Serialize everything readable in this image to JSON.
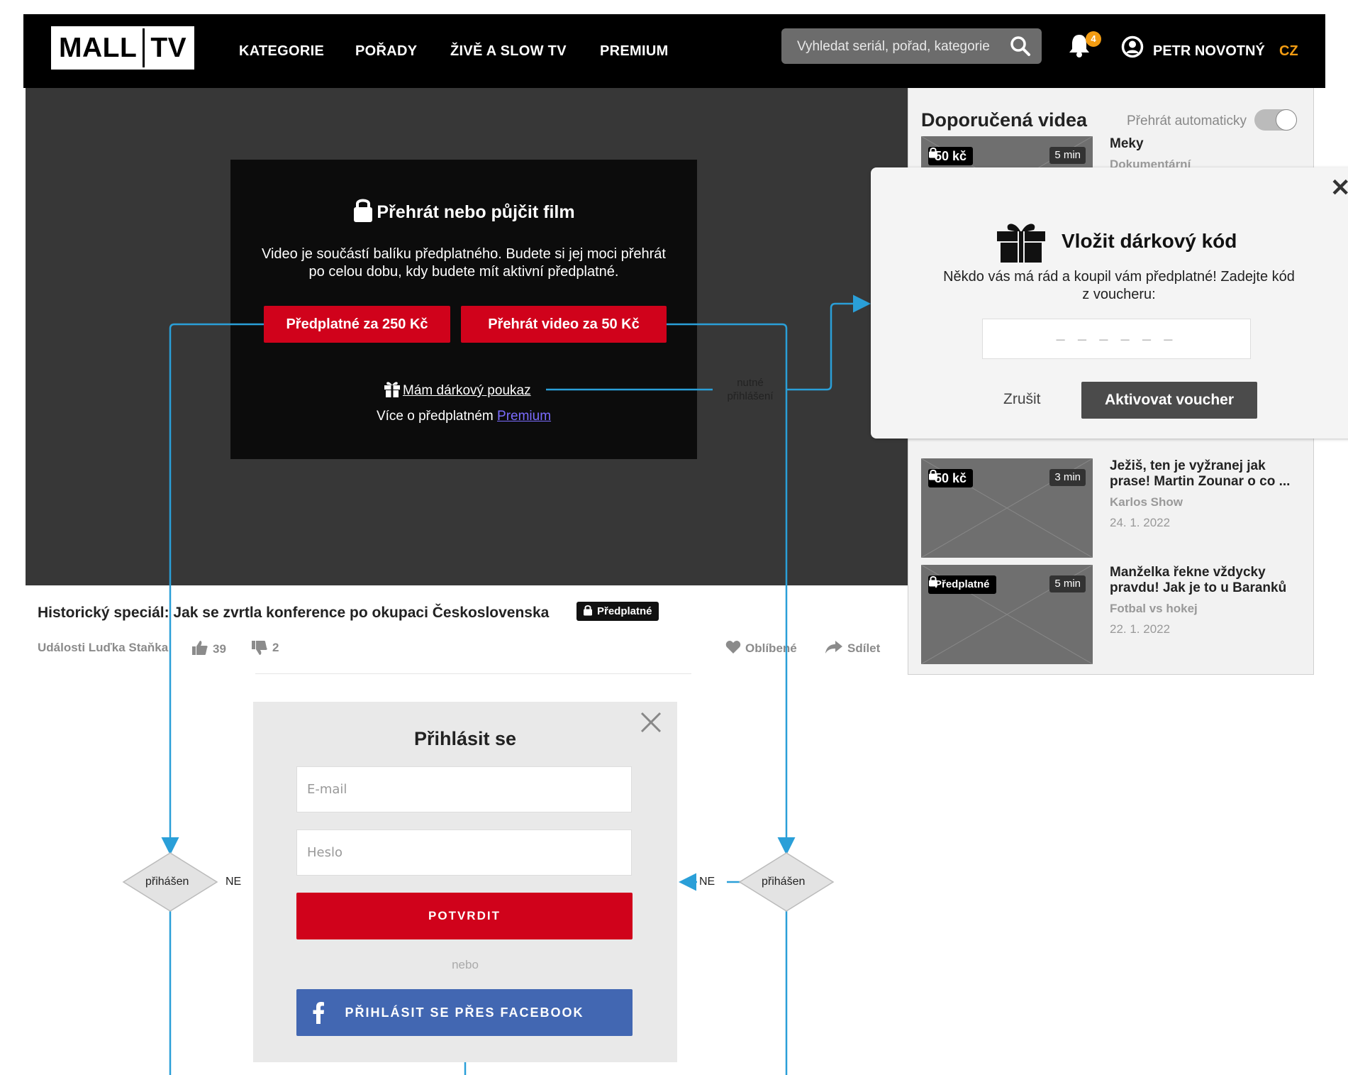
{
  "header": {
    "logo_left": "MALL",
    "logo_right": "TV",
    "nav": [
      "KATEGORIE",
      "POŘADY",
      "ŽIVĚ A SLOW TV",
      "PREMIUM"
    ],
    "search_placeholder": "Vyhledat seriál, pořad, kategorie",
    "notifications_count": "4",
    "user_name": "PETR NOVOTNÝ",
    "lang": "CZ"
  },
  "paywall": {
    "title": "Přehrát nebo půjčit film",
    "text": "Video je součástí balíku předplatného. Budete si jej moci přehrát po celou dobu, kdy budete mít aktivní předplatné.",
    "subscribe_btn": "Předplatné za 250 Kč",
    "rent_btn": "Přehrát video za 50 Kč",
    "gift_link": "Mám dárkový poukaz",
    "more_text": "Více o předplatném",
    "more_link": "Premium"
  },
  "video": {
    "title": "Historický speciál: Jak se zvrtla konference po okupaci Československa",
    "badge": "Předplatné",
    "channel": "Události Luďka Staňka",
    "likes": "39",
    "dislikes": "2",
    "favorite": "Oblíbené",
    "share": "Sdílet"
  },
  "sidebar": {
    "title": "Doporučená videa",
    "autoplay_label": "Přehrát automaticky",
    "autoplay_on": true,
    "items": [
      {
        "price": "50 kč",
        "duration": "5 min",
        "title": "Meky",
        "channel": "Dokumentární",
        "date": ""
      },
      {
        "price": "50 kč",
        "duration": "3 min",
        "title": "Ježiš, ten je vyžranej jak prase! Martin Zounar o co ...",
        "channel": "Karlos Show",
        "date": "24. 1. 2022"
      },
      {
        "price": "Předplatné",
        "duration": "5 min",
        "title": "Manželka řekne vždycky pravdu! Jak je to u Baranků",
        "channel": "Fotbal vs hokej",
        "date": "22. 1. 2022"
      }
    ]
  },
  "voucher": {
    "title": "Vložit dárkový kód",
    "text": "Někdo vás má rád a koupil vám předplatné! Zadejte kód z voucheru:",
    "placeholder": "– – – – – –",
    "cancel": "Zrušit",
    "activate": "Aktivovat voucher"
  },
  "login": {
    "title": "Přihlásit se",
    "email_placeholder": "E-mail",
    "password_placeholder": "Heslo",
    "submit": "POTVRDIT",
    "or": "nebo",
    "facebook": "PŘIHLÁSIT SE PŘES FACEBOOK"
  },
  "flow": {
    "note_required_login": [
      "nutné",
      "přihlášení"
    ],
    "decision_left": "přihášen",
    "decision_right": "přihášen",
    "no_label_left": "NE",
    "no_label_right": "NE",
    "line_color": "#2a9fd8"
  },
  "colors": {
    "accent_red": "#d0021b",
    "accent_orange": "#f39c12",
    "facebook_blue": "#4267b2"
  }
}
